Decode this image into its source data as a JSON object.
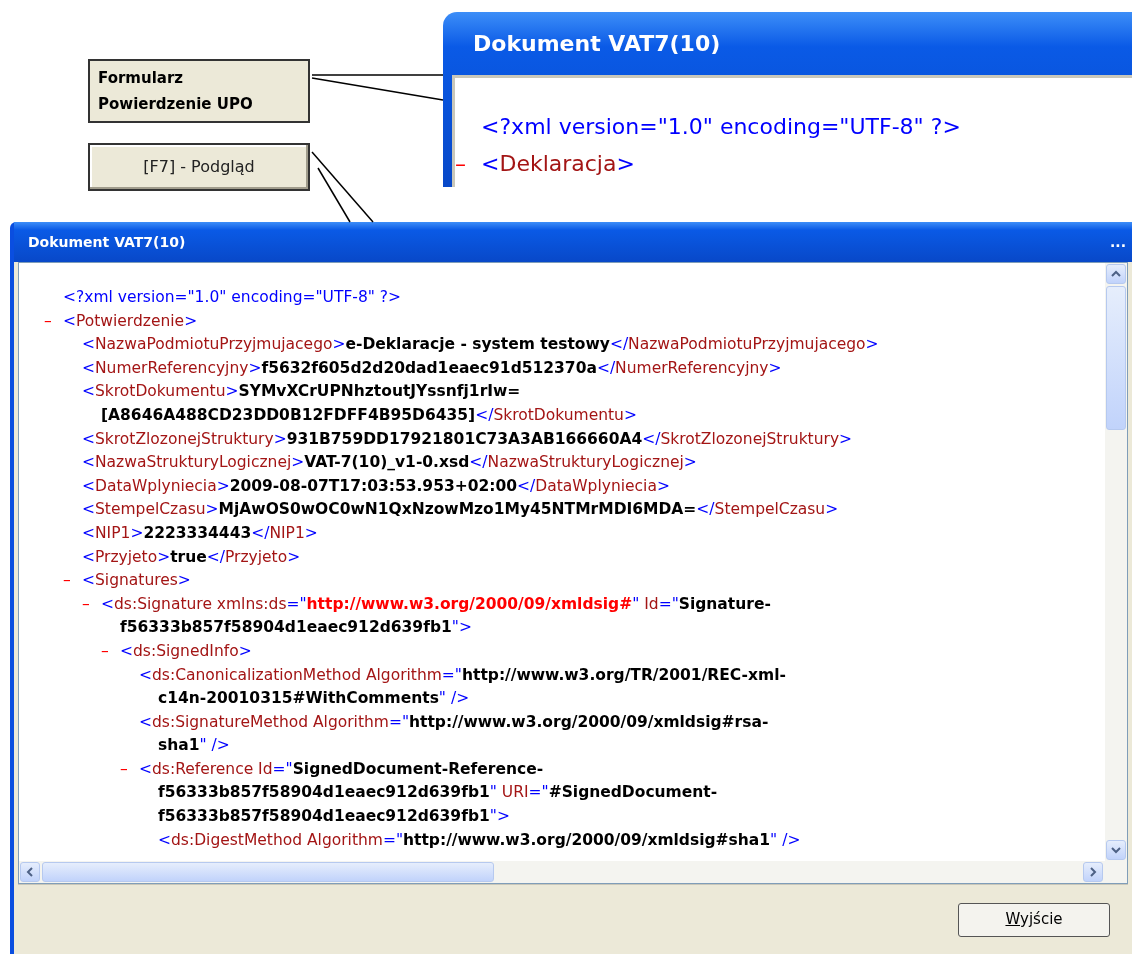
{
  "callout": {
    "label_lines": [
      "Formularz",
      "Powierdzenie UPO"
    ],
    "button": "[F7] - Podgląd"
  },
  "inset_window": {
    "title": "Dokument VAT7(10)",
    "nodes": [
      {
        "lines": [
          [
            {
              "kind": "mark",
              "text": "<?xml version=\"1.0\" encoding=\"UTF-8\" ?>"
            }
          ]
        ]
      },
      {
        "toggle": "–",
        "lines": [
          [
            {
              "kind": "mark",
              "text": "<"
            },
            {
              "kind": "name",
              "text": "Deklaracja"
            },
            {
              "kind": "mark",
              "text": ">"
            }
          ]
        ]
      }
    ]
  },
  "window": {
    "title": "Dokument VAT7(10)",
    "title_button": "...",
    "nodes": [
      {
        "lines": [
          [
            {
              "kind": "mark",
              "text": "<?xml version=\"1.0\" encoding=\"UTF-8\" ?>"
            }
          ]
        ]
      },
      {
        "toggle": "–",
        "lines": [
          [
            {
              "kind": "mark",
              "text": "<"
            },
            {
              "kind": "name",
              "text": "Potwierdzenie"
            },
            {
              "kind": "mark",
              "text": ">"
            }
          ]
        ],
        "children": [
          {
            "lines": [
              [
                {
                  "kind": "mark",
                  "text": "<"
                },
                {
                  "kind": "name",
                  "text": "NazwaPodmiotuPrzyjmujacego"
                },
                {
                  "kind": "mark",
                  "text": ">"
                },
                {
                  "kind": "value",
                  "text": "e-Deklaracje - system testowy"
                },
                {
                  "kind": "mark",
                  "text": "</"
                },
                {
                  "kind": "name",
                  "text": "NazwaPodmiotuPrzyjmujacego"
                },
                {
                  "kind": "mark",
                  "text": ">"
                }
              ]
            ]
          },
          {
            "lines": [
              [
                {
                  "kind": "mark",
                  "text": "<"
                },
                {
                  "kind": "name",
                  "text": "NumerReferencyjny"
                },
                {
                  "kind": "mark",
                  "text": ">"
                },
                {
                  "kind": "value",
                  "text": "f5632f605d2d20dad1eaec91d512370a"
                },
                {
                  "kind": "mark",
                  "text": "</"
                },
                {
                  "kind": "name",
                  "text": "NumerReferencyjny"
                },
                {
                  "kind": "mark",
                  "text": ">"
                }
              ]
            ]
          },
          {
            "lines": [
              [
                {
                  "kind": "mark",
                  "text": "<"
                },
                {
                  "kind": "name",
                  "text": "SkrotDokumentu"
                },
                {
                  "kind": "mark",
                  "text": ">"
                },
                {
                  "kind": "value",
                  "text": "SYMvXCrUPNhztoutJYssnfj1rIw="
                }
              ],
              [
                {
                  "kind": "value",
                  "text": "[A8646A488CD23DD0B12FDFF4B95D6435]"
                },
                {
                  "kind": "mark",
                  "text": "</"
                },
                {
                  "kind": "name",
                  "text": "SkrotDokumentu"
                },
                {
                  "kind": "mark",
                  "text": ">"
                }
              ]
            ]
          },
          {
            "lines": [
              [
                {
                  "kind": "mark",
                  "text": "<"
                },
                {
                  "kind": "name",
                  "text": "SkrotZlozonejStruktury"
                },
                {
                  "kind": "mark",
                  "text": ">"
                },
                {
                  "kind": "value",
                  "text": "931B759DD17921801C73A3AB166660A4"
                },
                {
                  "kind": "mark",
                  "text": "</"
                },
                {
                  "kind": "name",
                  "text": "SkrotZlozonejStruktury"
                },
                {
                  "kind": "mark",
                  "text": ">"
                }
              ]
            ]
          },
          {
            "lines": [
              [
                {
                  "kind": "mark",
                  "text": "<"
                },
                {
                  "kind": "name",
                  "text": "NazwaStrukturyLogicznej"
                },
                {
                  "kind": "mark",
                  "text": ">"
                },
                {
                  "kind": "value",
                  "text": "VAT-7(10)_v1-0.xsd"
                },
                {
                  "kind": "mark",
                  "text": "</"
                },
                {
                  "kind": "name",
                  "text": "NazwaStrukturyLogicznej"
                },
                {
                  "kind": "mark",
                  "text": ">"
                }
              ]
            ]
          },
          {
            "lines": [
              [
                {
                  "kind": "mark",
                  "text": "<"
                },
                {
                  "kind": "name",
                  "text": "DataWplyniecia"
                },
                {
                  "kind": "mark",
                  "text": ">"
                },
                {
                  "kind": "value",
                  "text": "2009-08-07T17:03:53.953+02:00"
                },
                {
                  "kind": "mark",
                  "text": "</"
                },
                {
                  "kind": "name",
                  "text": "DataWplyniecia"
                },
                {
                  "kind": "mark",
                  "text": ">"
                }
              ]
            ]
          },
          {
            "lines": [
              [
                {
                  "kind": "mark",
                  "text": "<"
                },
                {
                  "kind": "name",
                  "text": "StempelCzasu"
                },
                {
                  "kind": "mark",
                  "text": ">"
                },
                {
                  "kind": "value",
                  "text": "MjAwOS0wOC0wN1QxNzowMzo1My45NTMrMDI6MDA="
                },
                {
                  "kind": "mark",
                  "text": "</"
                },
                {
                  "kind": "name",
                  "text": "StempelCzasu"
                },
                {
                  "kind": "mark",
                  "text": ">"
                }
              ]
            ]
          },
          {
            "lines": [
              [
                {
                  "kind": "mark",
                  "text": "<"
                },
                {
                  "kind": "name",
                  "text": "NIP1"
                },
                {
                  "kind": "mark",
                  "text": ">"
                },
                {
                  "kind": "value",
                  "text": "2223334443"
                },
                {
                  "kind": "mark",
                  "text": "</"
                },
                {
                  "kind": "name",
                  "text": "NIP1"
                },
                {
                  "kind": "mark",
                  "text": ">"
                }
              ]
            ]
          },
          {
            "lines": [
              [
                {
                  "kind": "mark",
                  "text": "<"
                },
                {
                  "kind": "name",
                  "text": "Przyjeto"
                },
                {
                  "kind": "mark",
                  "text": ">"
                },
                {
                  "kind": "value",
                  "text": "true"
                },
                {
                  "kind": "mark",
                  "text": "</"
                },
                {
                  "kind": "name",
                  "text": "Przyjeto"
                },
                {
                  "kind": "mark",
                  "text": ">"
                }
              ]
            ]
          },
          {
            "toggle": "–",
            "lines": [
              [
                {
                  "kind": "mark",
                  "text": "<"
                },
                {
                  "kind": "name",
                  "text": "Signatures"
                },
                {
                  "kind": "mark",
                  "text": ">"
                }
              ]
            ],
            "children": [
              {
                "toggle": "–",
                "lines": [
                  [
                    {
                      "kind": "mark",
                      "text": "<"
                    },
                    {
                      "kind": "name",
                      "text": "ds:Signature xmlns:ds"
                    },
                    {
                      "kind": "mark",
                      "text": "=\""
                    },
                    {
                      "kind": "link",
                      "text": "http://www.w3.org/2000/09/xmldsig#"
                    },
                    {
                      "kind": "mark",
                      "text": "\""
                    },
                    {
                      "kind": "name",
                      "text": " Id"
                    },
                    {
                      "kind": "mark",
                      "text": "=\""
                    },
                    {
                      "kind": "value",
                      "text": "Signature-"
                    }
                  ],
                  [
                    {
                      "kind": "value",
                      "text": "f56333b857f58904d1eaec912d639fb1"
                    },
                    {
                      "kind": "mark",
                      "text": "\">"
                    }
                  ]
                ],
                "children": [
                  {
                    "toggle": "–",
                    "lines": [
                      [
                        {
                          "kind": "mark",
                          "text": "<"
                        },
                        {
                          "kind": "name",
                          "text": "ds:SignedInfo"
                        },
                        {
                          "kind": "mark",
                          "text": ">"
                        }
                      ]
                    ],
                    "children": [
                      {
                        "lines": [
                          [
                            {
                              "kind": "mark",
                              "text": "<"
                            },
                            {
                              "kind": "name",
                              "text": "ds:CanonicalizationMethod Algorithm"
                            },
                            {
                              "kind": "mark",
                              "text": "=\""
                            },
                            {
                              "kind": "value",
                              "text": "http://www.w3.org/TR/2001/REC-xml-"
                            }
                          ],
                          [
                            {
                              "kind": "value",
                              "text": "c14n-20010315#WithComments"
                            },
                            {
                              "kind": "mark",
                              "text": "\" />"
                            }
                          ]
                        ]
                      },
                      {
                        "lines": [
                          [
                            {
                              "kind": "mark",
                              "text": "<"
                            },
                            {
                              "kind": "name",
                              "text": "ds:SignatureMethod Algorithm"
                            },
                            {
                              "kind": "mark",
                              "text": "=\""
                            },
                            {
                              "kind": "value",
                              "text": "http://www.w3.org/2000/09/xmldsig#rsa-"
                            }
                          ],
                          [
                            {
                              "kind": "value",
                              "text": "sha1"
                            },
                            {
                              "kind": "mark",
                              "text": "\" />"
                            }
                          ]
                        ]
                      },
                      {
                        "toggle": "–",
                        "lines": [
                          [
                            {
                              "kind": "mark",
                              "text": "<"
                            },
                            {
                              "kind": "name",
                              "text": "ds:Reference Id"
                            },
                            {
                              "kind": "mark",
                              "text": "=\""
                            },
                            {
                              "kind": "value",
                              "text": "SignedDocument-Reference-"
                            }
                          ],
                          [
                            {
                              "kind": "value",
                              "text": "f56333b857f58904d1eaec912d639fb1"
                            },
                            {
                              "kind": "mark",
                              "text": "\""
                            },
                            {
                              "kind": "name",
                              "text": " URI"
                            },
                            {
                              "kind": "mark",
                              "text": "=\""
                            },
                            {
                              "kind": "value",
                              "text": "#SignedDocument-"
                            }
                          ],
                          [
                            {
                              "kind": "value",
                              "text": "f56333b857f58904d1eaec912d639fb1"
                            },
                            {
                              "kind": "mark",
                              "text": "\">"
                            }
                          ]
                        ],
                        "children": [
                          {
                            "lines": [
                              [
                                {
                                  "kind": "mark",
                                  "text": "<"
                                },
                                {
                                  "kind": "name",
                                  "text": "ds:DigestMethod Algorithm"
                                },
                                {
                                  "kind": "mark",
                                  "text": "=\""
                                },
                                {
                                  "kind": "value",
                                  "text": "http://www.w3.org/2000/09/xmldsig#sha1"
                                },
                                {
                                  "kind": "mark",
                                  "text": "\" />"
                                }
                              ]
                            ]
                          }
                        ]
                      }
                    ]
                  }
                ]
              }
            ]
          }
        ]
      }
    ],
    "exit_button": {
      "label_parts": [
        {
          "text": "W",
          "underlined": true
        },
        {
          "text": "yjście",
          "underlined": false
        }
      ]
    }
  }
}
